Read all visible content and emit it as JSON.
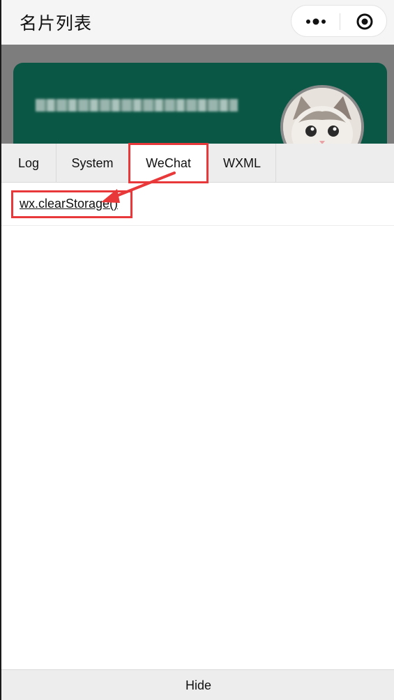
{
  "navbar": {
    "title": "名片列表",
    "more_icon": "more-dots-icon",
    "close_icon": "target-close-icon"
  },
  "background_page": {
    "card_color": "#0b5745",
    "avatar_icon": "cat-avatar"
  },
  "vconsole": {
    "tabs": [
      {
        "label": "Log",
        "active": false
      },
      {
        "label": "System",
        "active": false
      },
      {
        "label": "WeChat",
        "active": true
      },
      {
        "label": "WXML",
        "active": false
      }
    ],
    "commands": [
      {
        "label": "wx.clearStorage()"
      }
    ],
    "hide_label": "Hide"
  },
  "annotations": {
    "color": "#e8383a"
  }
}
